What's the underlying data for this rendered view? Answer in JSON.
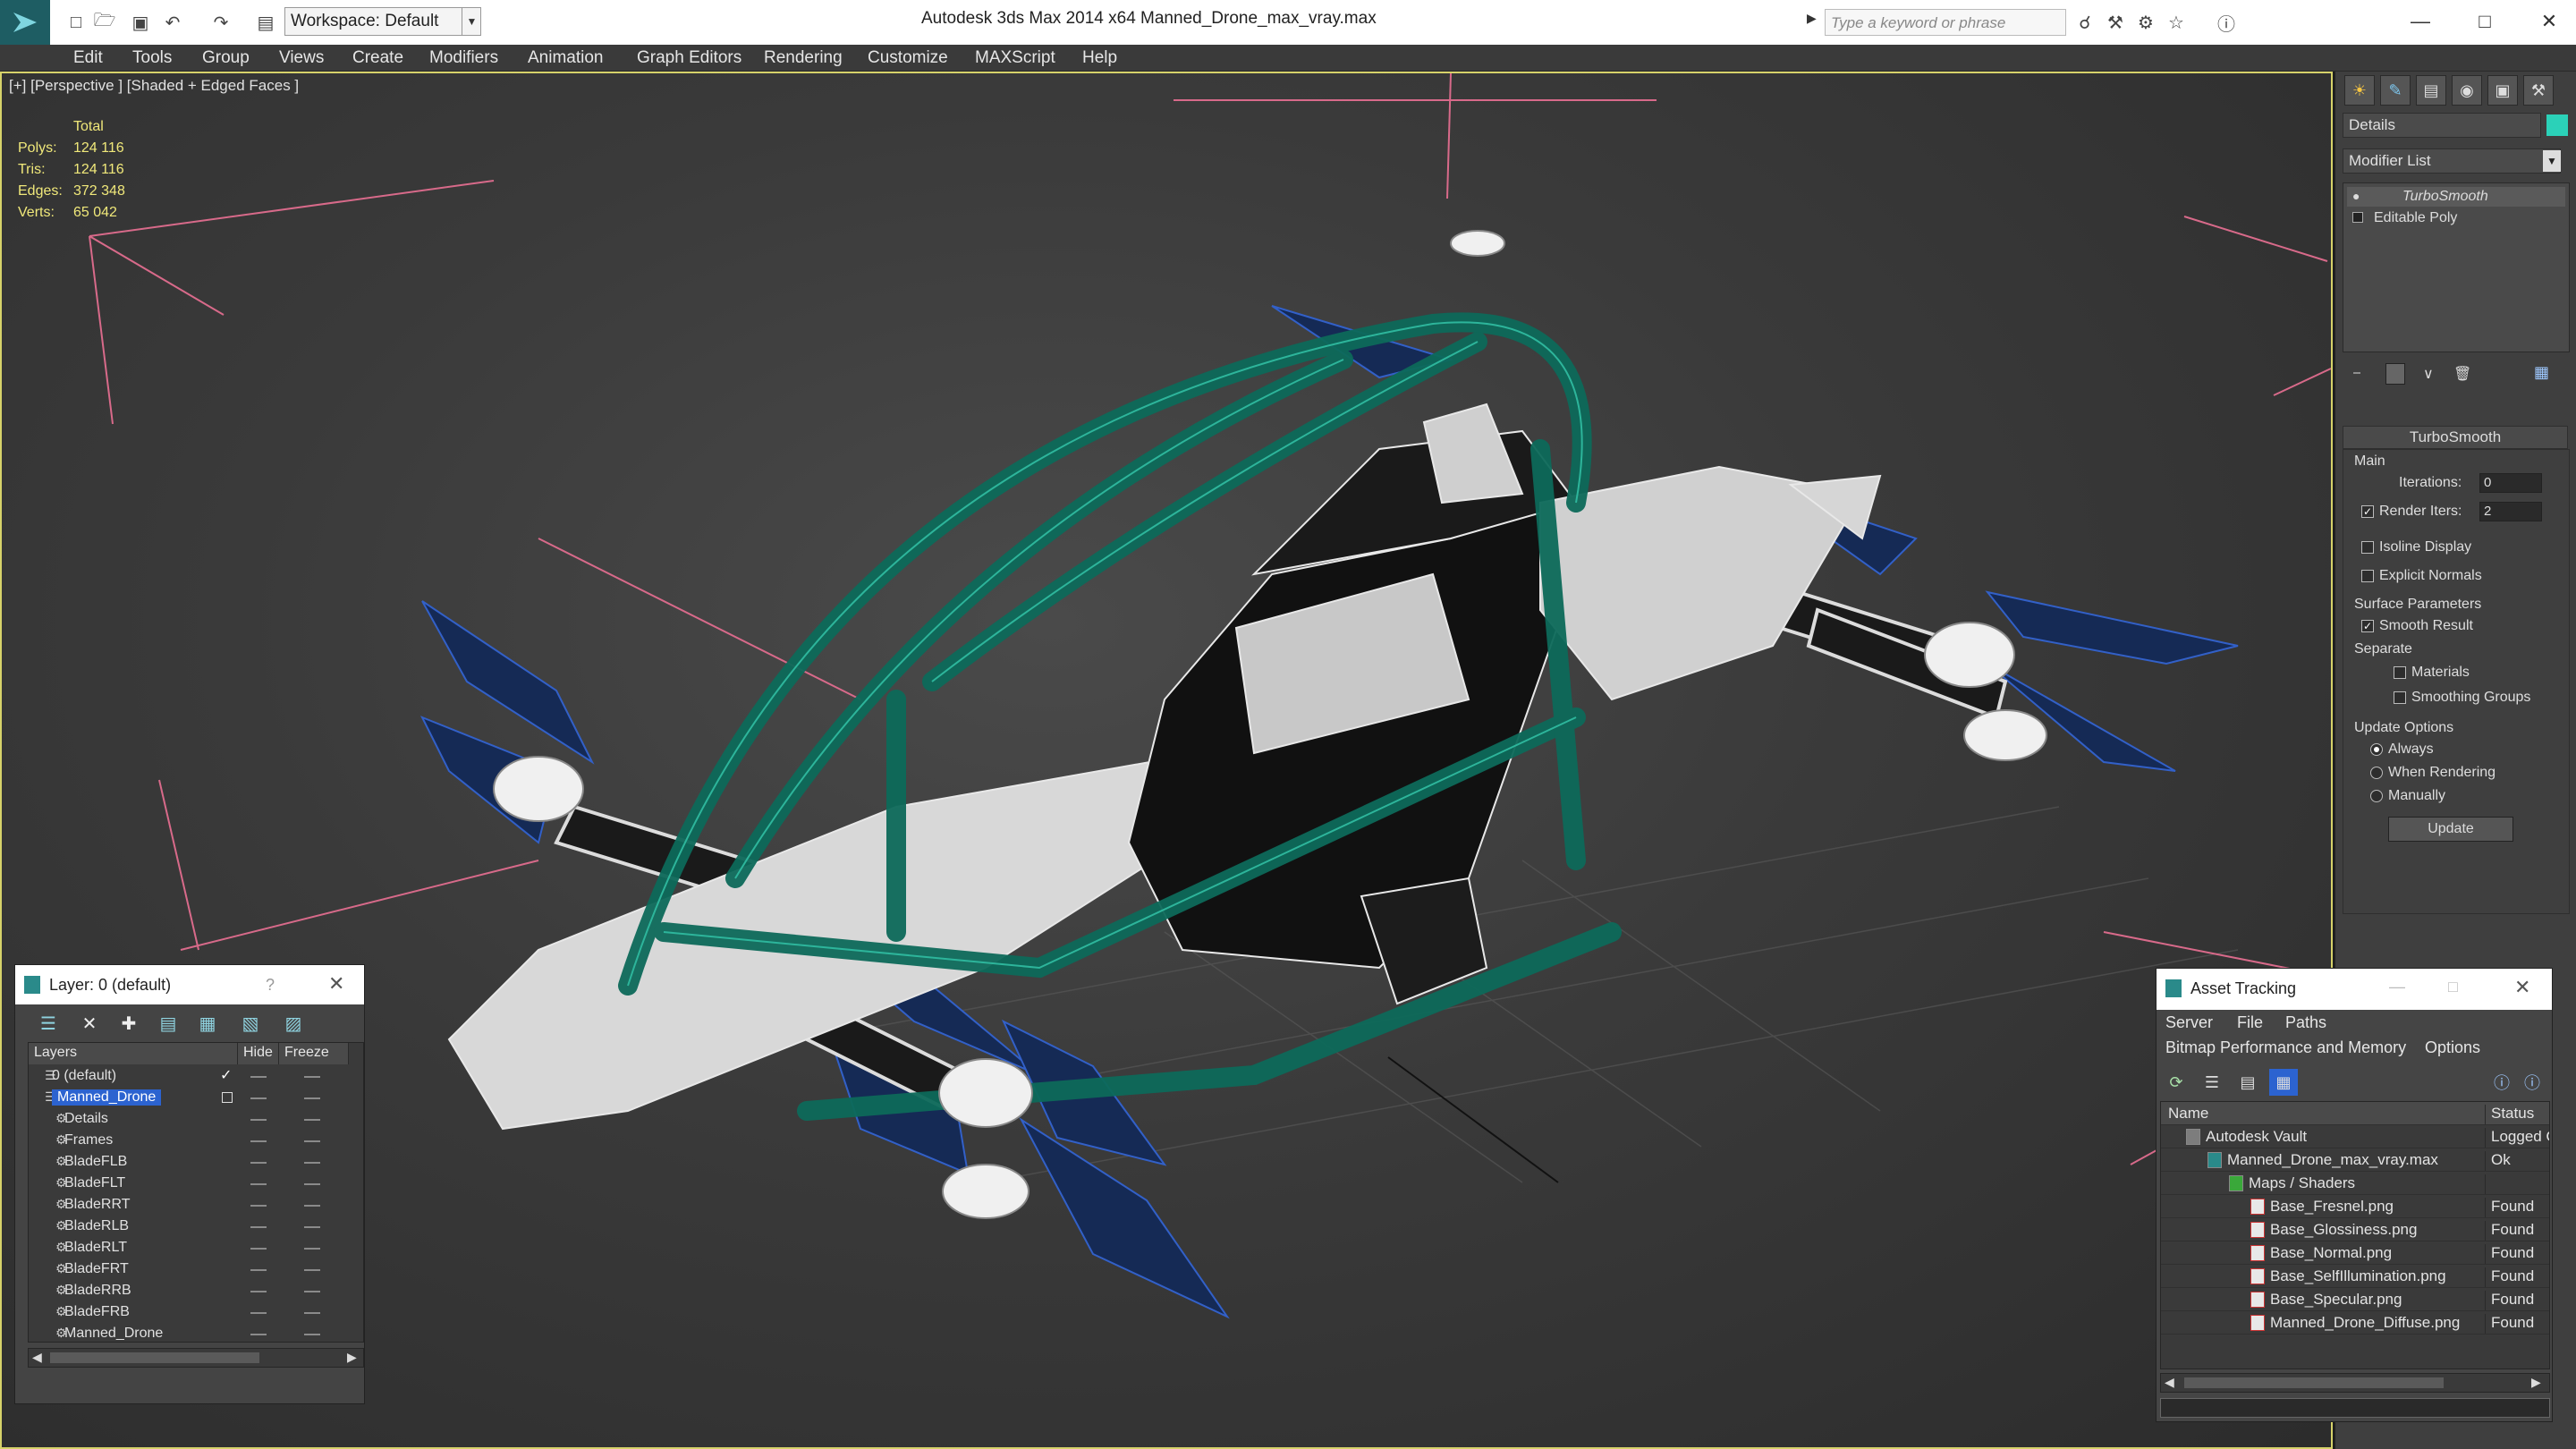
{
  "titlebar": {
    "workspace_label": "Workspace: Default",
    "app_title": "Autodesk 3ds Max  2014 x64      Manned_Drone_max_vray.max",
    "search_placeholder": "Type a keyword or phrase"
  },
  "menu": [
    "Edit",
    "Tools",
    "Group",
    "Views",
    "Create",
    "Modifiers",
    "Animation",
    "Graph Editors",
    "Rendering",
    "Customize",
    "MAXScript",
    "Help"
  ],
  "viewport": {
    "label": "[+] [Perspective ] [Shaded + Edged Faces ]",
    "stats_header": "Total",
    "stats": [
      {
        "label": "Polys:",
        "value": "124 116"
      },
      {
        "label": "Tris:",
        "value": "124 116"
      },
      {
        "label": "Edges:",
        "value": "372 348"
      },
      {
        "label": "Verts:",
        "value": "65 042"
      }
    ]
  },
  "command_panel": {
    "object_name": "Details",
    "object_color": "#2bd1b8",
    "modifier_list_label": "Modifier List",
    "stack": [
      "TurboSmooth",
      "Editable Poly"
    ],
    "rollout_title": "TurboSmooth",
    "main_group": "Main",
    "iterations_label": "Iterations:",
    "iterations_value": "0",
    "render_iters_label": "Render Iters:",
    "render_iters_value": "2",
    "render_iters_checked": true,
    "isoline_label": "Isoline Display",
    "explicit_normals_label": "Explicit Normals",
    "surface_group": "Surface Parameters",
    "smooth_result_label": "Smooth Result",
    "separate_label": "Separate",
    "materials_label": "Materials",
    "smoothing_groups_label": "Smoothing Groups",
    "update_group": "Update Options",
    "update_always": "Always",
    "update_when_rendering": "When Rendering",
    "update_manually": "Manually",
    "update_button": "Update"
  },
  "layer_window": {
    "title": "Layer: 0 (default)",
    "help": "?",
    "col_layers": "Layers",
    "col_hide": "Hide",
    "col_freeze": "Freeze",
    "rows": [
      {
        "name": "0 (default)",
        "indent": 0,
        "type": "layer"
      },
      {
        "name": "Manned_Drone",
        "indent": 0,
        "type": "layer",
        "selected": true
      },
      {
        "name": "Details",
        "indent": 1,
        "type": "object"
      },
      {
        "name": "Frames",
        "indent": 1,
        "type": "object"
      },
      {
        "name": "BladeFLB",
        "indent": 1,
        "type": "object"
      },
      {
        "name": "BladeFLT",
        "indent": 1,
        "type": "object"
      },
      {
        "name": "BladeRRT",
        "indent": 1,
        "type": "object"
      },
      {
        "name": "BladeRLB",
        "indent": 1,
        "type": "object"
      },
      {
        "name": "BladeRLT",
        "indent": 1,
        "type": "object"
      },
      {
        "name": "BladeFRT",
        "indent": 1,
        "type": "object"
      },
      {
        "name": "BladeRRB",
        "indent": 1,
        "type": "object"
      },
      {
        "name": "BladeFRB",
        "indent": 1,
        "type": "object"
      },
      {
        "name": "Manned_Drone",
        "indent": 1,
        "type": "object"
      }
    ]
  },
  "asset_window": {
    "title": "Asset Tracking",
    "menu": [
      "Server",
      "File",
      "Paths"
    ],
    "menu2": [
      "Bitmap Performance and Memory",
      "Options"
    ],
    "col_name": "Name",
    "col_status": "Status",
    "rows": [
      {
        "name": "Autodesk Vault",
        "status": "Logged O",
        "indent": 0
      },
      {
        "name": "Manned_Drone_max_vray.max",
        "status": "Ok",
        "indent": 1
      },
      {
        "name": "Maps / Shaders",
        "status": "",
        "indent": 2
      },
      {
        "name": "Base_Fresnel.png",
        "status": "Found",
        "indent": 3
      },
      {
        "name": "Base_Glossiness.png",
        "status": "Found",
        "indent": 3
      },
      {
        "name": "Base_Normal.png",
        "status": "Found",
        "indent": 3
      },
      {
        "name": "Base_SelfIllumination.png",
        "status": "Found",
        "indent": 3
      },
      {
        "name": "Base_Specular.png",
        "status": "Found",
        "indent": 3
      },
      {
        "name": "Manned_Drone_Diffuse.png",
        "status": "Found",
        "indent": 3
      }
    ]
  }
}
